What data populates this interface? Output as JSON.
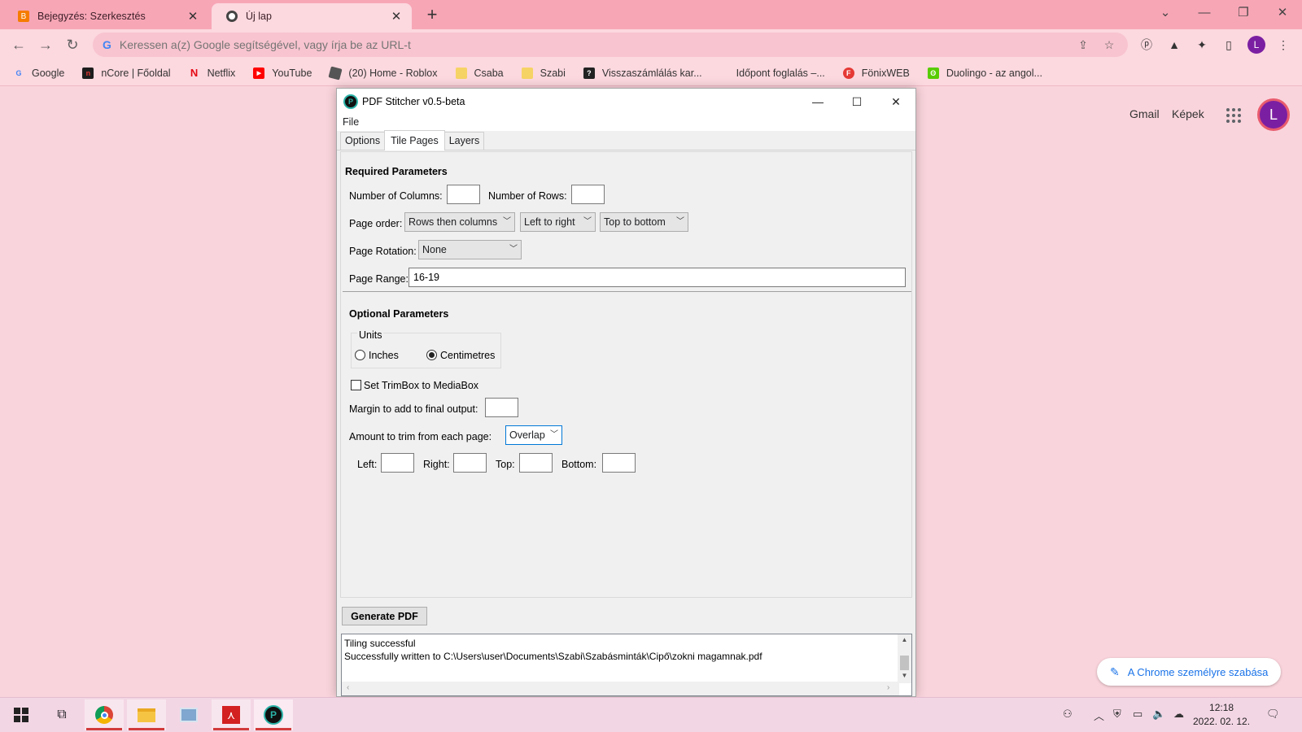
{
  "browser": {
    "tabs": [
      {
        "title": "Bejegyzés: Szerkesztés",
        "icon": "blogger-icon",
        "active": false
      },
      {
        "title": "Új lap",
        "icon": "chrome-icon",
        "active": true
      }
    ],
    "omnibox_placeholder": "Keressen a(z) Google segítségével, vagy írja be az URL-t",
    "profile_letter": "L",
    "bookmarks": [
      {
        "label": "Google",
        "icon": "google-icon",
        "color": "#ffffff"
      },
      {
        "label": "nCore | Főoldal",
        "icon": "ncore-icon",
        "color": "#1d1d1d"
      },
      {
        "label": "Netflix",
        "icon": "netflix-icon",
        "color": "#e50914"
      },
      {
        "label": "YouTube",
        "icon": "youtube-icon",
        "color": "#ff0000"
      },
      {
        "label": "(20) Home - Roblox",
        "icon": "roblox-icon",
        "color": "#444444"
      },
      {
        "label": "Csaba",
        "icon": "folder-icon",
        "color": "#f6d365"
      },
      {
        "label": "Szabi",
        "icon": "folder-icon",
        "color": "#f6d365"
      },
      {
        "label": "Visszaszámlálás kar...",
        "icon": "countdown-icon",
        "color": "#222222"
      },
      {
        "label": "Időpont foglalás –...",
        "icon": "",
        "color": "transparent"
      },
      {
        "label": "FönixWEB",
        "icon": "fonixweb-icon",
        "color": "#e53935"
      },
      {
        "label": "Duolingo - az angol...",
        "icon": "duolingo-icon",
        "color": "#58cc02"
      }
    ]
  },
  "google": {
    "gmail": "Gmail",
    "images": "Képek",
    "avatar_letter": "L",
    "customize": "A Chrome személyre szabása"
  },
  "app": {
    "title": "PDF Stitcher v0.5-beta",
    "menu_file": "File",
    "tabs": [
      "Options",
      "Tile Pages",
      "Layers"
    ],
    "required_header": "Required Parameters",
    "num_columns_label": "Number of Columns:",
    "num_columns_value": "",
    "num_rows_label": "Number of Rows:",
    "num_rows_value": "",
    "page_order_label": "Page order:",
    "page_order_value": "Rows then columns",
    "horizontal_value": "Left to right",
    "vertical_value": "Top to bottom",
    "rotation_label": "Page Rotation:",
    "rotation_value": "None",
    "range_label": "Page Range:",
    "range_value": "16-19",
    "optional_header": "Optional Parameters",
    "units_label": "Units",
    "unit_inches": "Inches",
    "unit_cm": "Centimetres",
    "trimbox_label": "Set TrimBox to MediaBox",
    "margin_label": "Margin to add to final output:",
    "margin_value": "",
    "trim_label": "Amount to trim from each page:",
    "trim_mode": "Overlap",
    "left_label": "Left:",
    "right_label": "Right:",
    "top_label": "Top:",
    "bottom_label": "Bottom:",
    "generate_label": "Generate PDF",
    "log_line1": "Tiling successful",
    "log_line2": "Successfully written to C:\\Users\\user\\Documents\\Szabi\\Szabásminták\\Cipő\\zokni magamnak.pdf"
  },
  "taskbar": {
    "time": "12:18",
    "date": "2022. 02. 12."
  }
}
